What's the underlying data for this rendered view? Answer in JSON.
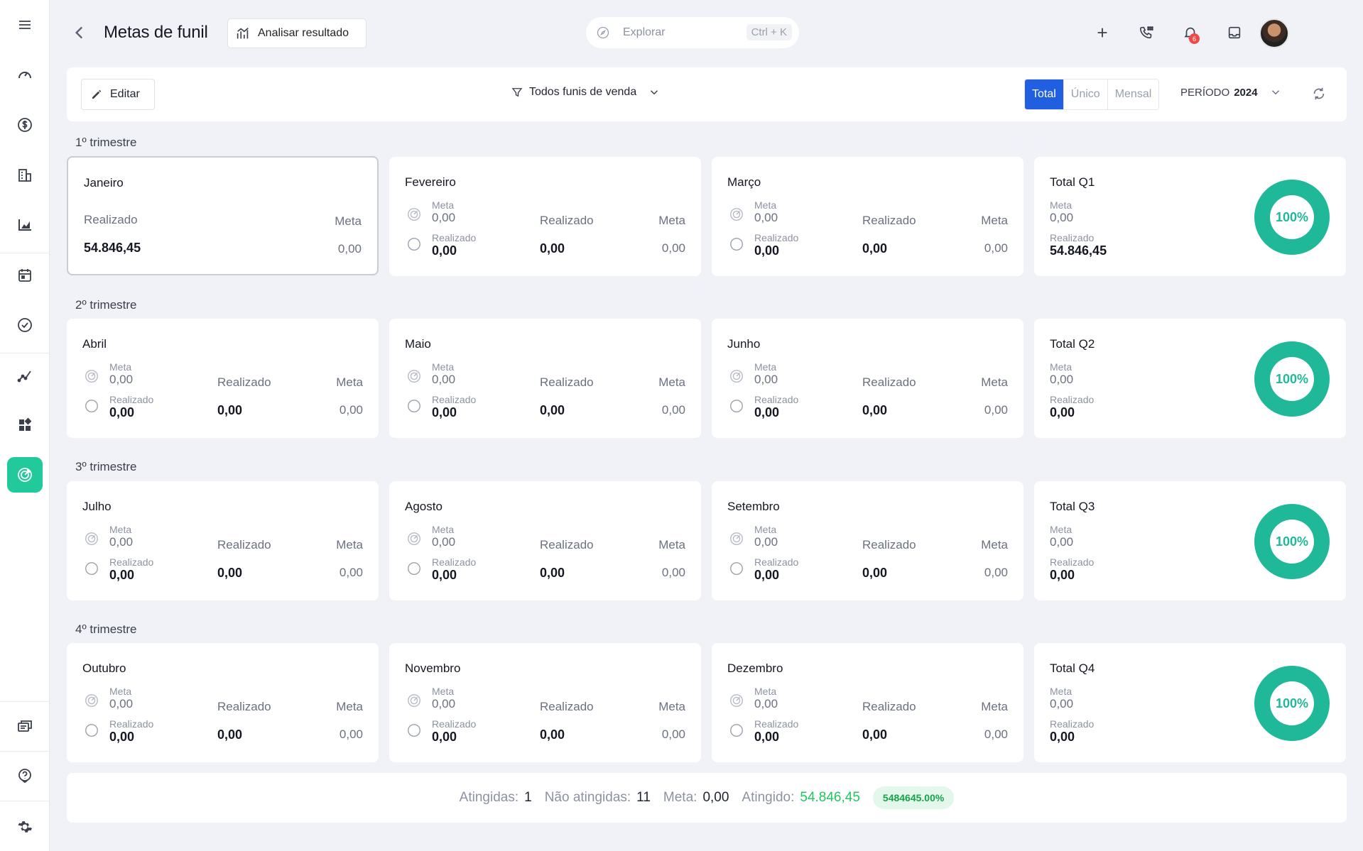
{
  "header": {
    "title": "Metas de funil",
    "analyze_label": "Analisar resultado",
    "search_placeholder": "Explorar",
    "search_shortcut": "Ctrl + K",
    "notifications_count": "6"
  },
  "toolbar": {
    "edit_label": "Editar",
    "funnel_label": "Todos funis de venda",
    "segments": [
      "Total",
      "Único",
      "Mensal"
    ],
    "active_segment": "Total",
    "period_label": "PERÍODO",
    "period_year": "2024"
  },
  "labels": {
    "meta": "Meta",
    "realizado": "Realizado"
  },
  "quarters": [
    {
      "label": "1º trimestre",
      "months": [
        {
          "name": "Janeiro",
          "meta": "0,00",
          "realizado": "54.846,45",
          "col_realizado": "54.846,45",
          "col_meta": "0,00"
        },
        {
          "name": "Fevereiro",
          "meta": "0,00",
          "realizado": "0,00",
          "col_realizado": "0,00",
          "col_meta": "0,00"
        },
        {
          "name": "Março",
          "meta": "0,00",
          "realizado": "0,00",
          "col_realizado": "0,00",
          "col_meta": "0,00"
        }
      ],
      "total": {
        "name": "Total Q1",
        "meta": "0,00",
        "realizado": "54.846,45",
        "percent": "100%"
      }
    },
    {
      "label": "2º trimestre",
      "months": [
        {
          "name": "Abril",
          "meta": "0,00",
          "realizado": "0,00",
          "col_realizado": "0,00",
          "col_meta": "0,00"
        },
        {
          "name": "Maio",
          "meta": "0,00",
          "realizado": "0,00",
          "col_realizado": "0,00",
          "col_meta": "0,00"
        },
        {
          "name": "Junho",
          "meta": "0,00",
          "realizado": "0,00",
          "col_realizado": "0,00",
          "col_meta": "0,00"
        }
      ],
      "total": {
        "name": "Total Q2",
        "meta": "0,00",
        "realizado": "0,00",
        "percent": "100%"
      }
    },
    {
      "label": "3º trimestre",
      "months": [
        {
          "name": "Julho",
          "meta": "0,00",
          "realizado": "0,00",
          "col_realizado": "0,00",
          "col_meta": "0,00"
        },
        {
          "name": "Agosto",
          "meta": "0,00",
          "realizado": "0,00",
          "col_realizado": "0,00",
          "col_meta": "0,00"
        },
        {
          "name": "Setembro",
          "meta": "0,00",
          "realizado": "0,00",
          "col_realizado": "0,00",
          "col_meta": "0,00"
        }
      ],
      "total": {
        "name": "Total Q3",
        "meta": "0,00",
        "realizado": "0,00",
        "percent": "100%"
      }
    },
    {
      "label": "4º trimestre",
      "months": [
        {
          "name": "Outubro",
          "meta": "0,00",
          "realizado": "0,00",
          "col_realizado": "0,00",
          "col_meta": "0,00"
        },
        {
          "name": "Novembro",
          "meta": "0,00",
          "realizado": "0,00",
          "col_realizado": "0,00",
          "col_meta": "0,00"
        },
        {
          "name": "Dezembro",
          "meta": "0,00",
          "realizado": "0,00",
          "col_realizado": "0,00",
          "col_meta": "0,00"
        }
      ],
      "total": {
        "name": "Total Q4",
        "meta": "0,00",
        "realizado": "0,00",
        "percent": "100%"
      }
    }
  ],
  "summary": {
    "atingidas_label": "Atingidas:",
    "atingidas": "1",
    "nao_label": "Não atingidas:",
    "nao": "11",
    "meta_label": "Meta:",
    "meta": "0,00",
    "atingido_label": "Atingido:",
    "atingido": "54.846,45",
    "percent": "5484645.00%"
  },
  "colors": {
    "accent": "#22c99a",
    "primary": "#1f5fe0",
    "donut": "#1fb898",
    "success": "#22c55e",
    "badge": "#ef4a4a"
  }
}
